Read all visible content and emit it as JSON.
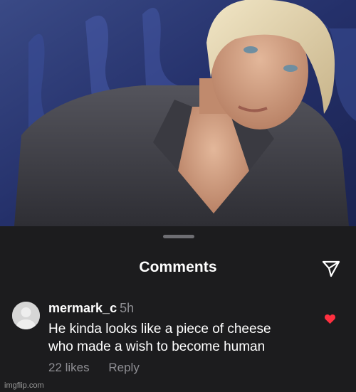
{
  "photo": {
    "description_icon": "portrait-photo"
  },
  "sheet": {
    "title": "Comments",
    "share_icon": "send-icon"
  },
  "comment": {
    "username": "mermark_c",
    "timestamp": "5h",
    "text_lines": [
      "He kinda looks like a piece of cheese",
      "who made a wish to become human"
    ],
    "likes": "22 likes",
    "reply_label": "Reply",
    "liked": true,
    "heart_color": "#ff3040"
  },
  "watermark": "imgflip.com",
  "colors": {
    "background": "#1c1c1e",
    "text": "#ffffff",
    "muted": "#8e8e93"
  }
}
